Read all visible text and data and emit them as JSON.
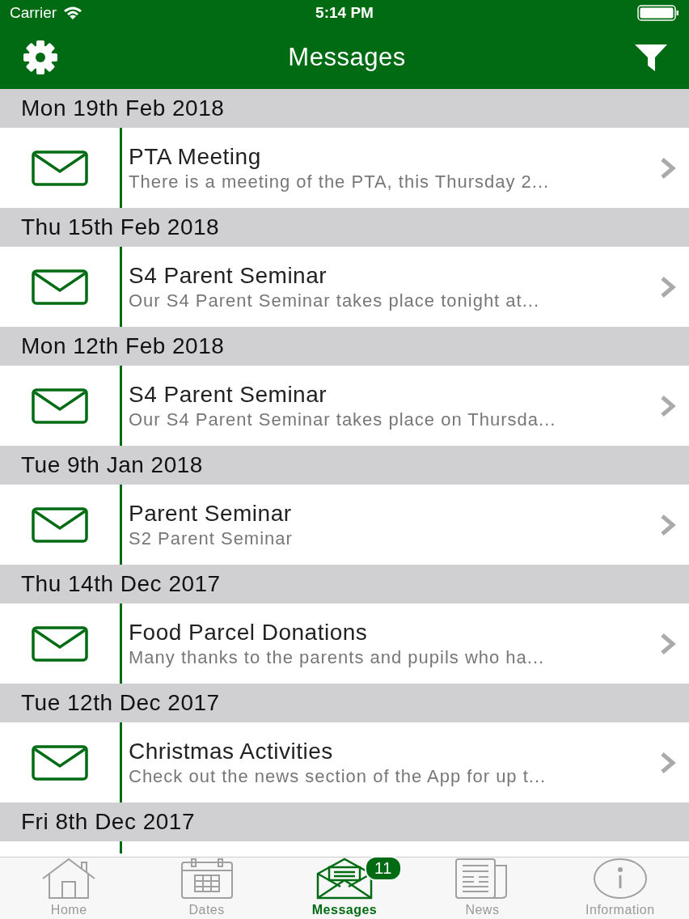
{
  "status_bar": {
    "carrier": "Carrier",
    "time": "5:14 PM"
  },
  "nav": {
    "title": "Messages"
  },
  "sections": [
    {
      "date": "Mon 19th Feb 2018",
      "messages": [
        {
          "title": "PTA Meeting",
          "preview": "There is a meeting of the PTA, this Thursday 2..."
        }
      ]
    },
    {
      "date": "Thu 15th Feb 2018",
      "messages": [
        {
          "title": "S4 Parent Seminar",
          "preview": "Our S4 Parent Seminar takes place tonight at..."
        }
      ]
    },
    {
      "date": "Mon 12th Feb 2018",
      "messages": [
        {
          "title": "S4 Parent Seminar",
          "preview": "Our S4 Parent Seminar takes place on Thursda..."
        }
      ]
    },
    {
      "date": "Tue 9th Jan 2018",
      "messages": [
        {
          "title": "Parent Seminar",
          "preview": "S2 Parent Seminar"
        }
      ]
    },
    {
      "date": "Thu 14th Dec 2017",
      "messages": [
        {
          "title": "Food Parcel Donations",
          "preview": "Many thanks to the parents and pupils who ha..."
        }
      ]
    },
    {
      "date": "Tue 12th Dec 2017",
      "messages": [
        {
          "title": "Christmas Activities",
          "preview": "Check out the news section of the App for up t..."
        }
      ]
    },
    {
      "date": "Fri 8th Dec 2017"
    }
  ],
  "tabs": [
    {
      "kind": "home",
      "label": "Home",
      "selected": false
    },
    {
      "kind": "dates",
      "label": "Dates",
      "selected": false
    },
    {
      "kind": "messages",
      "label": "Messages",
      "selected": true,
      "badge": "11"
    },
    {
      "kind": "news",
      "label": "News",
      "selected": false
    },
    {
      "kind": "information",
      "label": "Information",
      "selected": false
    }
  ]
}
